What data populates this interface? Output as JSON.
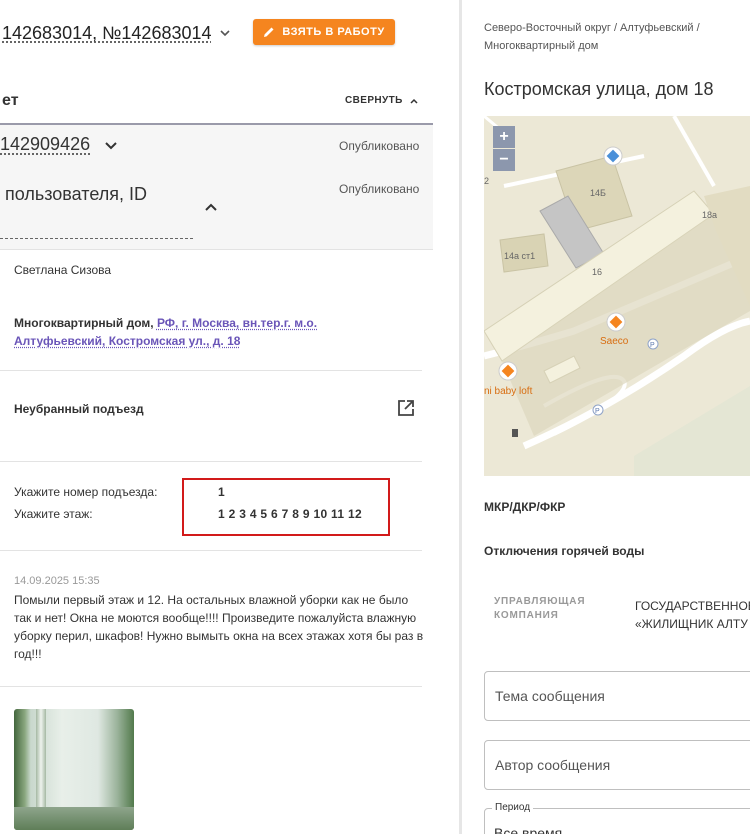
{
  "header": {
    "title": "142683014, №142683014",
    "take_button": "ВЗЯТЬ В РАБОТУ"
  },
  "section": {
    "title": "ет",
    "collapse_label": "СВЕРНУТЬ"
  },
  "ticket": {
    "id": "142909426",
    "status": "Опубликовано",
    "user_label": "пользователя, ID",
    "user_status": "Опубликовано"
  },
  "details": {
    "author": "Светлана Сизова",
    "object_type": "Многоквартирный дом,",
    "address_link": "РФ, г. Москва, вн.тер.г. м.о. Алтуфьевский, Костромская ул., д. 18",
    "problem": "Неубранный подъезд"
  },
  "fields": [
    {
      "label": "Укажите номер подъезда:",
      "value": "1"
    },
    {
      "label": "Укажите этаж:",
      "value": "1 2 3 4 5 6 7 8 9 10 11 12"
    }
  ],
  "comment": {
    "date": "14.09.2025 15:35",
    "text": "Помыли первый этаж и 12. На остальных влажной уборки как не было так и нет! Окна не моются вообще!!!! Произведите пожалуйста влажную уборку перил, шкафов! Нужно вымыть окна на всех этажах хотя бы раз в год!!!"
  },
  "right": {
    "breadcrumb_line1": "Северо-Восточный округ / Алтуфьевский /",
    "breadcrumb_line2": "Многоквартирный дом",
    "street": "Костромская улица, дом 18",
    "map": {
      "zoom_in": "+",
      "zoom_out": "−",
      "labels": {
        "b1": "14Б",
        "b2": "18а",
        "b3": "14а ст1",
        "b4": "16",
        "poi1": "Saeco",
        "poi2": "ni baby loft",
        "parking": "P",
        "edge": "2"
      }
    },
    "mkr_label": "МКР/ДКР/ФКР",
    "hot_water_label": "Отключения горячей воды",
    "uk_label": "УПРАВЛЯЮЩАЯ КОМПАНИЯ",
    "uk_value_line1": "ГОСУДАРСТВЕННОЕ",
    "uk_value_line2": "«ЖИЛИЩНИК АЛТУ",
    "subject_placeholder": "Тема сообщения",
    "author_placeholder": "Автор сообщения",
    "period_label": "Период",
    "period_value": "Все время"
  },
  "colors": {
    "accent_orange": "#f5851f",
    "link_purple": "#6a55b8",
    "highlight_red": "#d21a1a"
  }
}
